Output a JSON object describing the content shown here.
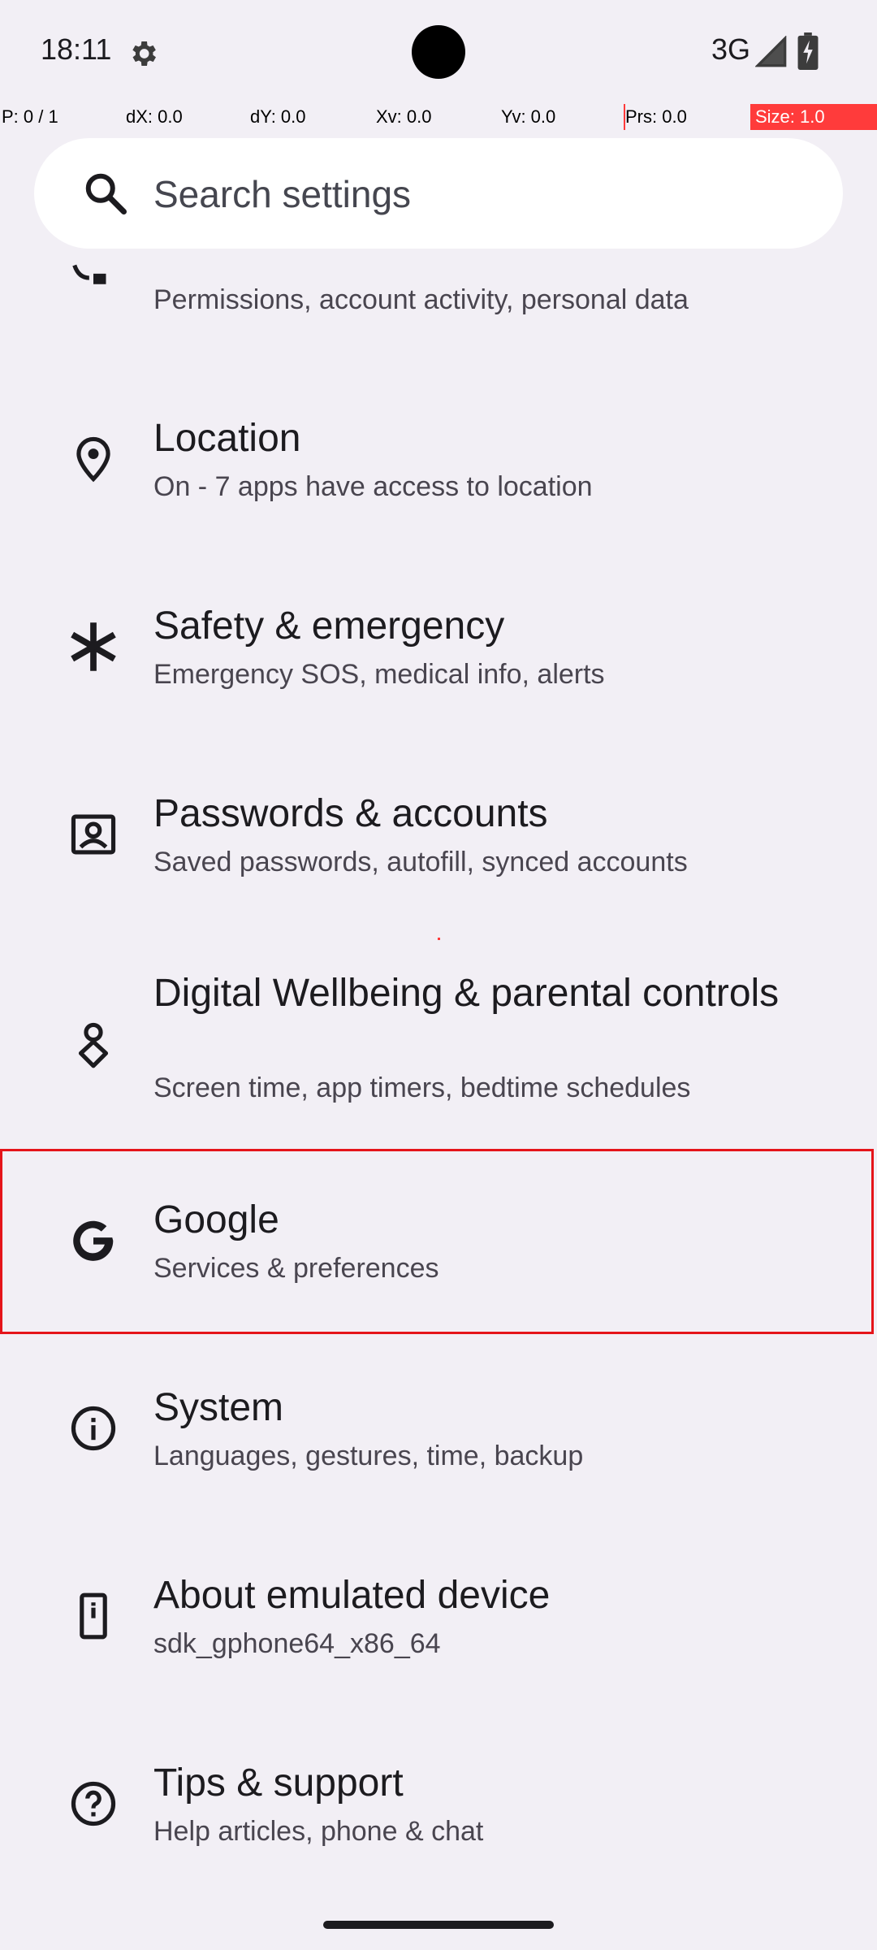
{
  "status_bar": {
    "time": "18:11",
    "network": "3G",
    "icons": [
      "gear-icon",
      "signal-icon",
      "battery-icon"
    ]
  },
  "debug": {
    "p": "P: 0 / 1",
    "dx": "dX: 0.0",
    "dy": "dY: 0.0",
    "xv": "Xv: 0.0",
    "yv": "Yv: 0.0",
    "prs": "Prs: 0.0",
    "size": "Size: 1.0"
  },
  "search": {
    "placeholder": "Search settings"
  },
  "items": [
    {
      "title": "",
      "subtitle": "Permissions, account activity, personal data",
      "icon": "privacy-icon"
    },
    {
      "title": "Location",
      "subtitle": "On - 7 apps have access to location",
      "icon": "location-pin-icon"
    },
    {
      "title": "Safety & emergency",
      "subtitle": "Emergency SOS, medical info, alerts",
      "icon": "asterisk-icon"
    },
    {
      "title": "Passwords & accounts",
      "subtitle": "Saved passwords, autofill, synced accounts",
      "icon": "account-box-icon"
    },
    {
      "title": "Digital Wellbeing & parental controls",
      "subtitle": "Screen time, app timers, bedtime schedules",
      "icon": "wellbeing-icon"
    },
    {
      "title": "Google",
      "subtitle": "Services & preferences",
      "icon": "google-g-icon"
    },
    {
      "title": "System",
      "subtitle": "Languages, gestures, time, backup",
      "icon": "info-icon"
    },
    {
      "title": "About emulated device",
      "subtitle": "sdk_gphone64_x86_64",
      "icon": "phone-icon"
    },
    {
      "title": "Tips & support",
      "subtitle": "Help articles, phone & chat",
      "icon": "help-icon"
    }
  ],
  "colors": {
    "background": "#f2eff5",
    "highlight": "#e5141a",
    "debug_accent": "#ff3b3b"
  }
}
